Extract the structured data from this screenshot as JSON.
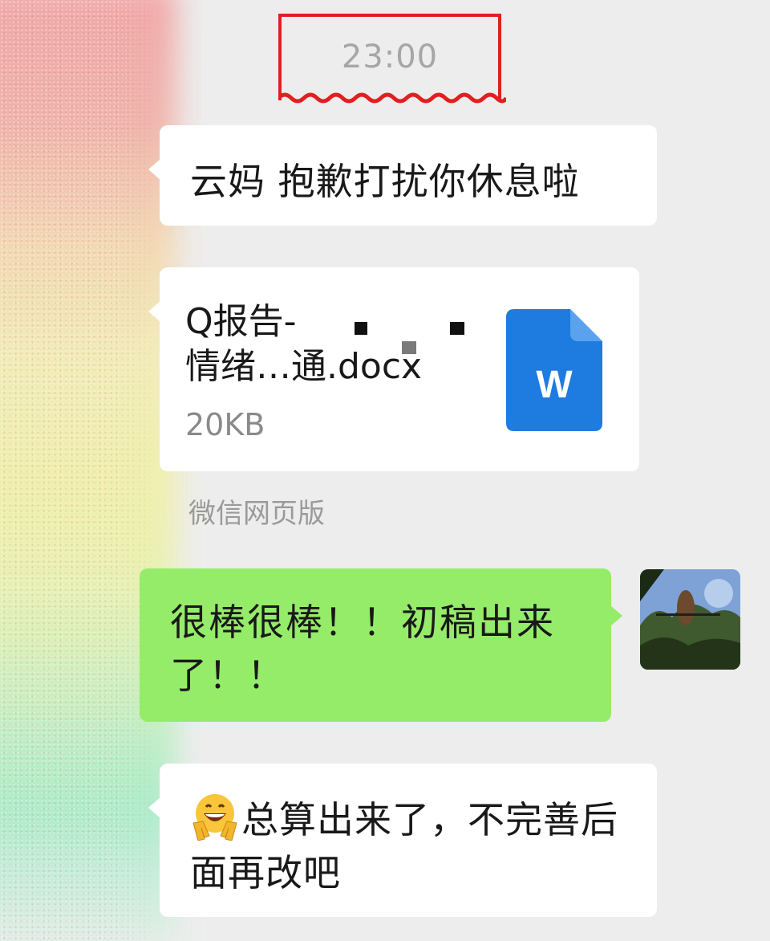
{
  "time_divider": "23:00",
  "messages": [
    {
      "text": "云妈 抱歉打扰你休息啦"
    },
    {
      "file_name": "Q报告-\n情绪…通.docx",
      "file_size": "20KB",
      "file_icon": "word-document-icon",
      "source": "微信网页版"
    },
    {
      "text": "很棒很棒！！初稿出来了！！"
    },
    {
      "emoji": "grinning-victory-emoji",
      "text": "总算出来了，不完善后面再改吧"
    }
  ],
  "colors": {
    "background": "#ededed",
    "incoming_bubble": "#ffffff",
    "outgoing_bubble": "#95ec69",
    "highlight_box": "#e02020",
    "word_blue": "#1e7be0"
  }
}
